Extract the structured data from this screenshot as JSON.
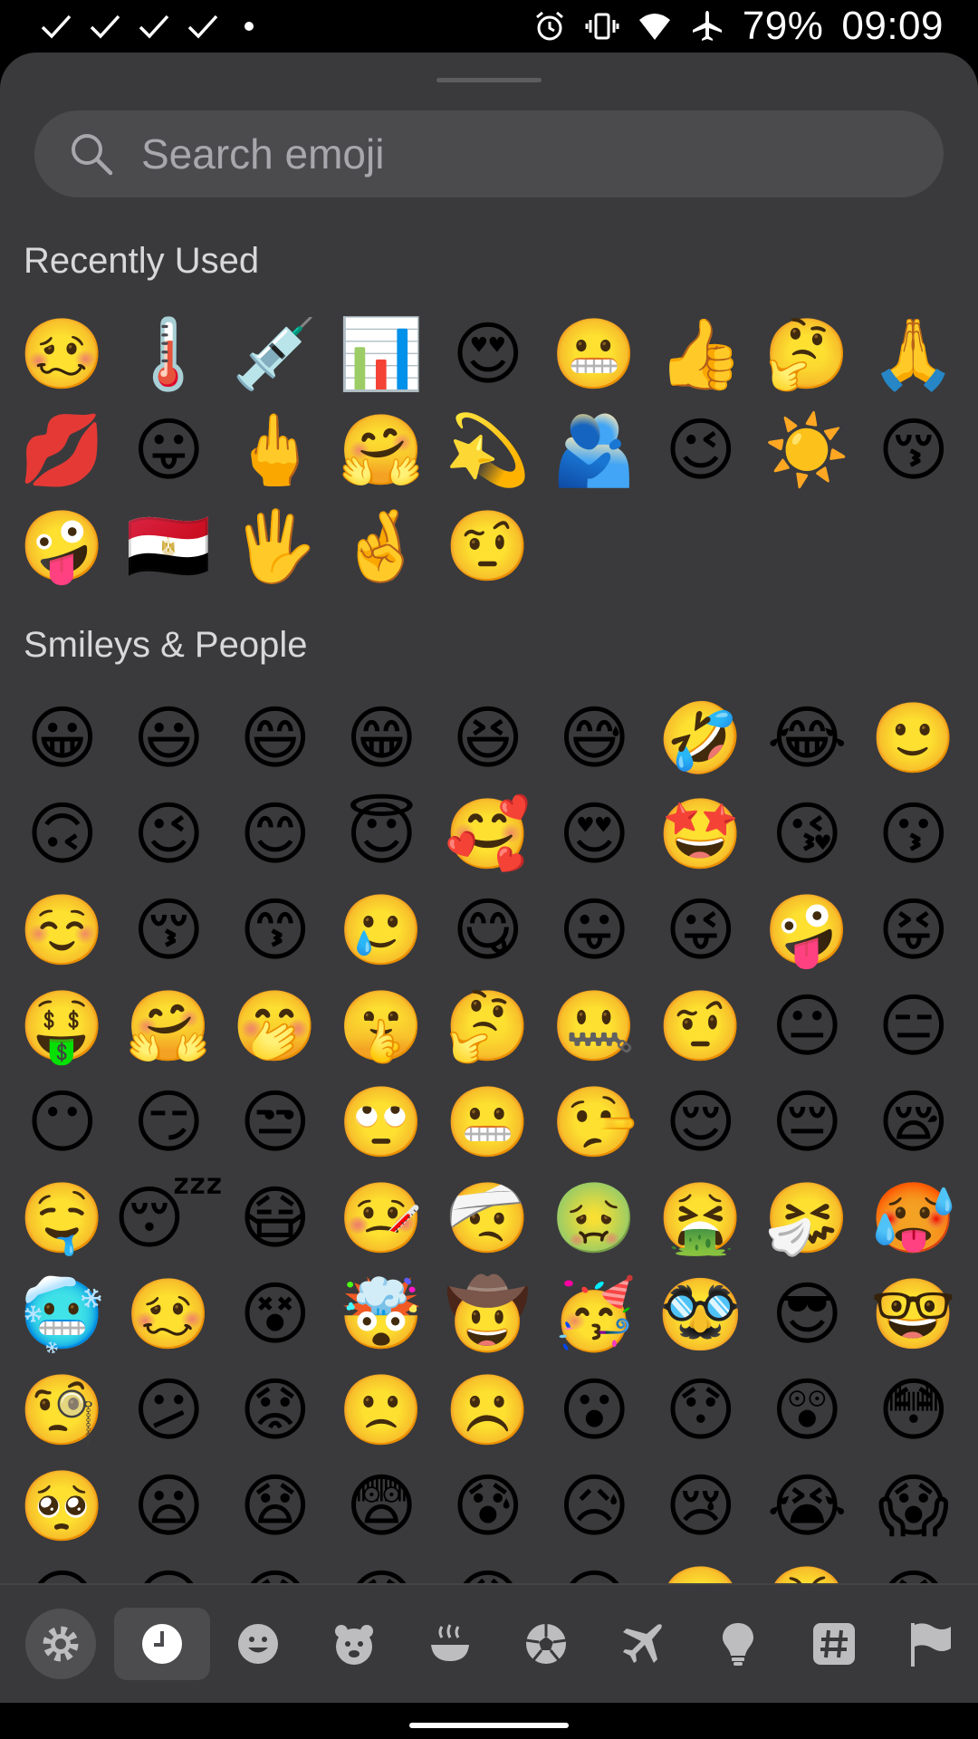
{
  "status_bar": {
    "battery": "79%",
    "time": "09:09",
    "icons": [
      "check-icon",
      "check-icon",
      "check-icon",
      "check-icon",
      "dot-icon",
      "alarm-icon",
      "vibrate-icon",
      "wifi-icon",
      "airplane-icon"
    ]
  },
  "search": {
    "placeholder": "Search emoji"
  },
  "sections": {
    "recent": {
      "title": "Recently Used",
      "emojis": [
        "🥴",
        "🌡️",
        "💉",
        "📊",
        "😍",
        "😬",
        "👍",
        "🤔",
        "🙏",
        "💋",
        "😛",
        "🖕",
        "🤗",
        "💫",
        "🫂",
        "😉",
        "☀️",
        "😚",
        "🤪",
        "🇪🇬",
        "🖐️",
        "🤞",
        "🤨"
      ]
    },
    "smileys": {
      "title": "Smileys & People",
      "emojis": [
        "😀",
        "😃",
        "😄",
        "😁",
        "😆",
        "😅",
        "🤣",
        "😂",
        "🙂",
        "🙃",
        "😉",
        "😊",
        "😇",
        "🥰",
        "😍",
        "🤩",
        "😘",
        "😗",
        "☺️",
        "😚",
        "😙",
        "🥲",
        "😋",
        "😛",
        "😜",
        "🤪",
        "😝",
        "🤑",
        "🤗",
        "🤭",
        "🤫",
        "🤔",
        "🤐",
        "🤨",
        "😐",
        "😑",
        "😶",
        "😏",
        "😒",
        "🙄",
        "😬",
        "🤥",
        "😌",
        "😔",
        "😪",
        "🤤",
        "😴",
        "😷",
        "🤒",
        "🤕",
        "🤢",
        "🤮",
        "🤧",
        "🥵",
        "🥶",
        "🥴",
        "😵",
        "🤯",
        "🤠",
        "🥳",
        "🥸",
        "😎",
        "🤓",
        "🧐",
        "😕",
        "😟",
        "🙁",
        "☹️",
        "😮",
        "😯",
        "😲",
        "😳",
        "🥺",
        "😦",
        "😧",
        "😨",
        "😰",
        "😥",
        "😢",
        "😭",
        "😱",
        "😖",
        "😣",
        "😞",
        "😓",
        "😩",
        "😫",
        "🥱",
        "😤",
        "😡"
      ]
    }
  },
  "bottom_bar": {
    "tabs": [
      "settings-icon",
      "recent-clock-icon",
      "smiley-icon",
      "bear-icon",
      "food-bowl-icon",
      "soccer-ball-icon",
      "airplane-icon",
      "lightbulb-icon",
      "hashtag-icon",
      "flag-icon"
    ],
    "active_tab": "recent-clock-icon"
  }
}
